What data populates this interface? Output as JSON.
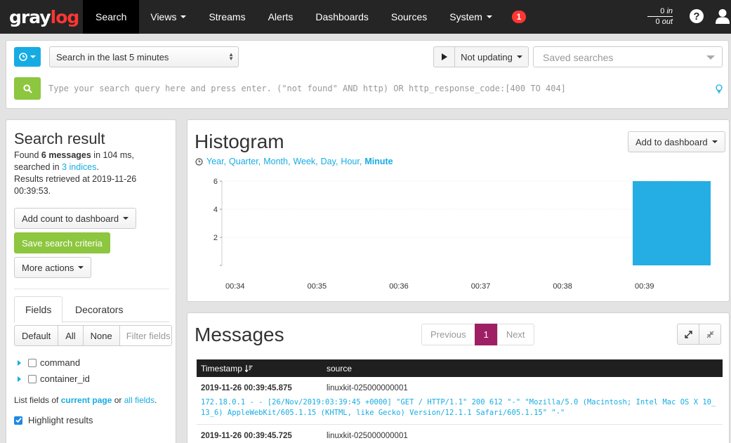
{
  "nav": {
    "logo_gray": "gray",
    "logo_accent": "log",
    "items": [
      {
        "label": "Search",
        "active": true,
        "dropdown": false
      },
      {
        "label": "Views",
        "active": false,
        "dropdown": true
      },
      {
        "label": "Streams",
        "active": false,
        "dropdown": false
      },
      {
        "label": "Alerts",
        "active": false,
        "dropdown": false
      },
      {
        "label": "Dashboards",
        "active": false,
        "dropdown": false
      },
      {
        "label": "Sources",
        "active": false,
        "dropdown": false
      },
      {
        "label": "System",
        "active": false,
        "dropdown": true
      }
    ],
    "notification_count": "1",
    "throughput_in_value": "0",
    "throughput_in_label": "in",
    "throughput_out_value": "0",
    "throughput_out_label": "out",
    "help_icon": "question-circle-icon",
    "user_icon": "user-icon"
  },
  "search": {
    "range_icon": "clock-icon",
    "range_value": "Search in the last 5 minutes",
    "update_value": "Not updating",
    "saved_searches_placeholder": "Saved searches",
    "query_placeholder": "Type your search query here and press enter. (\"not found\" AND http) OR http_response_code:[400 TO 404]",
    "search_icon": "search-icon",
    "hint_icon": "lightbulb-icon"
  },
  "sidebar": {
    "title": "Search result",
    "found_prefix": "Found ",
    "found_count": "6 messages",
    "found_suffix": " in 104 ms,",
    "searched_prefix": "searched in ",
    "searched_indices": "3 indices",
    "searched_suffix": ".",
    "retrieved": "Results retrieved at 2019-11-26 00:39:53.",
    "add_count_label": "Add count to dashboard",
    "save_search_label": "Save search criteria",
    "more_actions_label": "More actions",
    "tabs": [
      "Fields",
      "Decorators"
    ],
    "field_buttons": [
      "Default",
      "All",
      "None"
    ],
    "filter_placeholder": "Filter fields",
    "fields": [
      "command",
      "container_id"
    ],
    "list_prefix": "List fields of ",
    "list_current": "current page",
    "list_or": " or ",
    "list_all": "all fields",
    "list_suffix": ".",
    "highlight_label": "Highlight results"
  },
  "histogram": {
    "title": "Histogram",
    "add_to_dashboard_label": "Add to dashboard",
    "resolutions": [
      "Year,",
      "Quarter,",
      "Month,",
      "Week,",
      "Day,",
      "Hour,",
      "Minute"
    ],
    "selected_resolution": "Minute"
  },
  "chart_data": {
    "type": "bar",
    "categories": [
      "00:34",
      "00:35",
      "00:36",
      "00:37",
      "00:38",
      "00:39"
    ],
    "values": [
      0,
      0,
      0,
      0,
      0,
      6
    ],
    "yticks": [
      2,
      4,
      6
    ],
    "ylim": [
      0,
      6
    ],
    "bar_color": "#24aee3",
    "grid": true
  },
  "messages": {
    "title": "Messages",
    "pager": [
      "Previous",
      "1",
      "Next"
    ],
    "columns": [
      "Timestamp",
      "source"
    ],
    "rows": [
      {
        "timestamp": "2019-11-26 00:39:45.875",
        "source": "linuxkit-025000000001",
        "message": "172.18.0.1 - - [26/Nov/2019:03:39:45 +0000] \"GET / HTTP/1.1\" 200 612 \"-\" \"Mozilla/5.0 (Macintosh; Intel Mac OS X 10_13_6) AppleWebKit/605.1.15 (KHTML, like Gecko) Version/12.1.1 Safari/605.1.15\" \"-\""
      },
      {
        "timestamp": "2019-11-26 00:39:45.725",
        "source": "linuxkit-025000000001",
        "message": ""
      }
    ]
  },
  "colors": {
    "nav_bg": "#252525",
    "accent_blue": "#16ace3",
    "success_green": "#8dc63f",
    "alert_red": "#ff3633",
    "pager_active": "#9e1f63"
  }
}
